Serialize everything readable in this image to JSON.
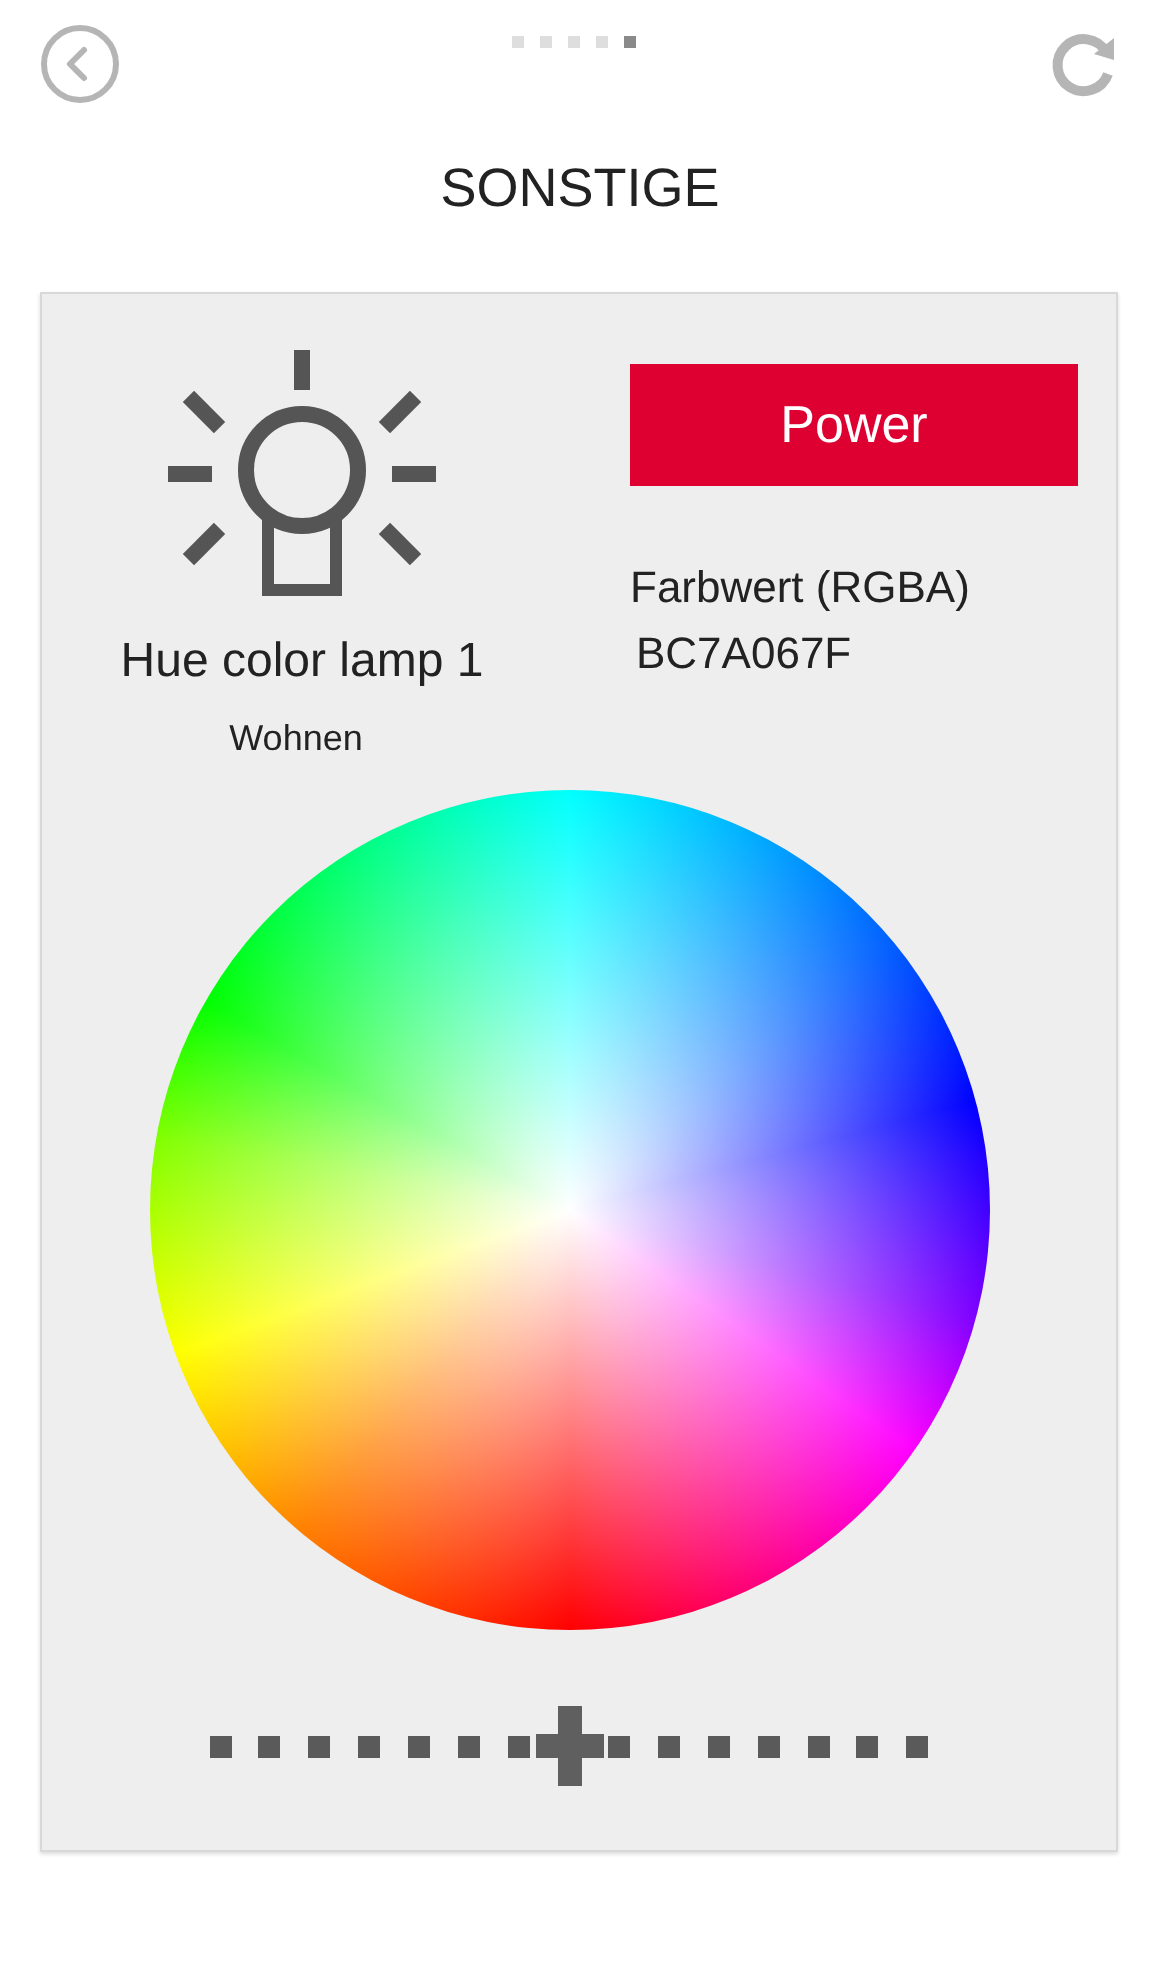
{
  "pager": [
    {
      "selected": false
    },
    {
      "selected": false
    },
    {
      "selected": false
    },
    {
      "selected": false
    },
    {
      "selected": true
    }
  ],
  "title": "SONSTIGE",
  "device": {
    "name": "Hue color lamp 1",
    "room": "Wohnen",
    "power_label": "Power",
    "color_label": "Farbwert (RGBA)",
    "color_value": "BC7A067F"
  },
  "brightness": {
    "level": 0.5
  }
}
